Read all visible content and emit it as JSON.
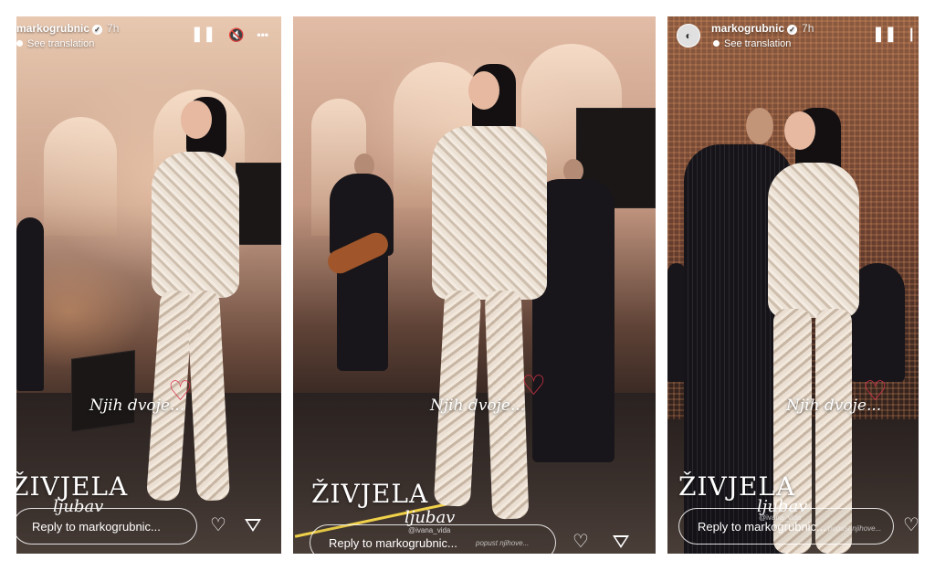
{
  "stories": [
    {
      "username": "markogrubnic",
      "time": "7h",
      "translation": "See translation",
      "show_avatar": false,
      "controls": {
        "pause": "❚❚",
        "mute": "🔇",
        "more": "•••"
      },
      "caption_script": "Njih dvoje...",
      "zivjela": "ŽIVJELA",
      "ljubav": "ljubav",
      "credit": "",
      "lyric": "",
      "reply_placeholder": "Reply to markogrubnic..."
    },
    {
      "username": "",
      "time": "",
      "translation": "",
      "show_avatar": false,
      "controls": null,
      "caption_script": "Njih dvoje...",
      "zivjela": "ŽIVJELA",
      "ljubav": "ljubav",
      "credit": "@ivana_vida",
      "lyric": "popust njihove...",
      "reply_placeholder": "Reply to markogrubnic..."
    },
    {
      "username": "markogrubnic",
      "time": "7h",
      "translation": "See translation",
      "show_avatar": true,
      "controls": {
        "pause": "❚❚"
      },
      "caption_script": "Njih dvoje...",
      "zivjela": "ŽIVJELA",
      "ljubav": "ljubav",
      "credit": "@ivana_vida",
      "lyric": "popust njihove...",
      "reply_placeholder": "Reply to markogrubnic..."
    }
  ],
  "colors": {
    "heart": "#d9324a",
    "accent_light": "#f0d14a"
  },
  "icons": {
    "verified": "verified-badge-icon",
    "pause": "pause-icon",
    "mute": "mute-icon",
    "more": "more-icon",
    "like": "heart-icon",
    "share": "send-icon",
    "caption_heart": "drawn-heart-icon"
  }
}
